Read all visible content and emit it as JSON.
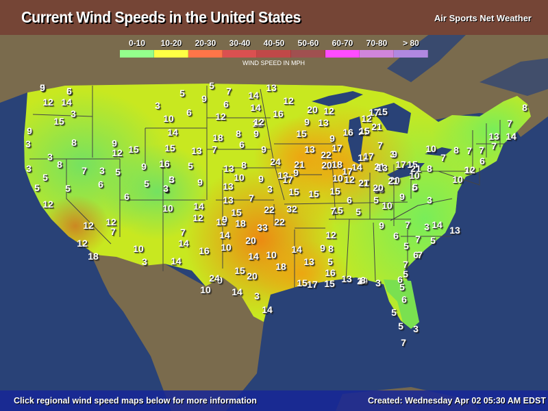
{
  "header": {
    "title": "Current Wind Speeds in the United States",
    "brand": "Air Sports Net Weather"
  },
  "legend": {
    "caption": "WIND SPEED IN MPH",
    "bins": [
      {
        "label": "0-10",
        "color": "#94FF8C"
      },
      {
        "label": "10-20",
        "color": "#FFFF44"
      },
      {
        "label": "20-30",
        "color": "#FF7548"
      },
      {
        "label": "30-40",
        "color": "#DA5050"
      },
      {
        "label": "40-50",
        "color": "#C04848"
      },
      {
        "label": "50-60",
        "color": "#A05050"
      },
      {
        "label": "60-70",
        "color": "#FF4CFF"
      },
      {
        "label": "70-80",
        "color": "#D085DA"
      },
      {
        "label": "> 80",
        "color": "#B088E0"
      }
    ]
  },
  "footer": {
    "instructions": "Click regional wind speed maps below for more information",
    "created": "Created: Wednesday Apr 02 05:30 AM EDST"
  },
  "colors": {
    "ocean": "#294277",
    "land_outside": "#7A6B4D",
    "header_bg": "#754536",
    "footer_bg": "#1A2A96"
  },
  "stations": [
    "5",
    "5",
    "12",
    "14",
    "3",
    "15",
    "9",
    "3",
    "8",
    "3",
    "8",
    "3",
    "5",
    "5",
    "12",
    "12",
    "12",
    "18",
    "12",
    "7",
    "5",
    "9",
    "12",
    "15",
    "7",
    "3",
    "5",
    "6",
    "9",
    "16",
    "5",
    "3",
    "5",
    "3",
    "6",
    "10",
    "3",
    "10",
    "5",
    "9",
    "3",
    "10",
    "6",
    "14",
    "15",
    "13",
    "16",
    "5",
    "9",
    "3",
    "3",
    "14",
    "12",
    "7",
    "14",
    "16",
    "14",
    "5",
    "7",
    "6",
    "12",
    "14",
    "14",
    "13",
    "12",
    "16",
    "12",
    "18",
    "8",
    "9",
    "7",
    "6",
    "12",
    "9",
    "13",
    "8",
    "10",
    "9",
    "13",
    "13",
    "3",
    "15",
    "7",
    "9",
    "15",
    "22",
    "32",
    "22",
    "33",
    "18",
    "13",
    "14",
    "20",
    "14",
    "10",
    "15",
    "20",
    "18",
    "9",
    "14",
    "3",
    "14",
    "10",
    "24",
    "10",
    "9",
    "15",
    "24",
    "21",
    "13",
    "17",
    "20",
    "12",
    "9",
    "13",
    "9",
    "17",
    "22",
    "20",
    "18",
    "16",
    "21",
    "14",
    "12",
    "21",
    "17",
    "21",
    "15",
    "12",
    "13",
    "15",
    "15",
    "10",
    "15",
    "12",
    "17",
    "13",
    "8",
    "5",
    "16",
    "15",
    "15",
    "13",
    "20",
    "14",
    "13",
    "17",
    "9",
    "7",
    "17",
    "9",
    "20",
    "5",
    "10",
    "9",
    "8",
    "3",
    "6",
    "5",
    "9",
    "7",
    "3",
    "6",
    "5",
    "7",
    "5",
    "7",
    "6",
    "5",
    "6",
    "5",
    "3",
    "6",
    "8",
    "14",
    "13",
    "7",
    "6",
    "5",
    "5",
    "3",
    "7",
    "10",
    "14",
    "8",
    "7",
    "10",
    "7",
    "15",
    "3",
    "9",
    "17",
    "21",
    "8",
    "7",
    "6",
    "12",
    "8",
    "7",
    "14",
    "13",
    "7",
    "9",
    "7",
    "17",
    "15",
    "13",
    "12",
    "21",
    "21",
    "20",
    "10",
    "5",
    "9",
    "6"
  ]
}
